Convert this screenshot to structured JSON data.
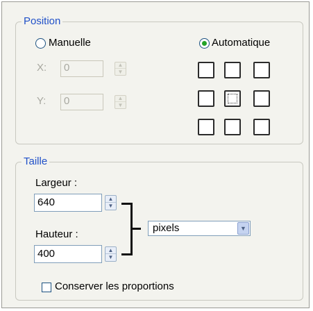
{
  "position": {
    "legend": "Position",
    "manual_label": "Manuelle",
    "auto_label": "Automatique",
    "x_label": "X:",
    "x_value": "0",
    "y_label": "Y:",
    "y_value": "0",
    "selected_mode": "automatique",
    "selected_anchor": "center"
  },
  "size": {
    "legend": "Taille",
    "width_label": "Largeur :",
    "width_value": "640",
    "height_label": "Hauteur :",
    "height_value": "400",
    "unit_value": "pixels",
    "keep_ratio_label": "Conserver les proportions",
    "keep_ratio_checked": false
  },
  "icons": {
    "spin_up": "arrow-up-icon",
    "spin_down": "arrow-down-icon",
    "dropdown": "chevron-down-icon"
  },
  "colors": {
    "legend_text": "#2050c8",
    "radio_selected": "#24a326",
    "panel_bg": "#f3f3ee"
  }
}
